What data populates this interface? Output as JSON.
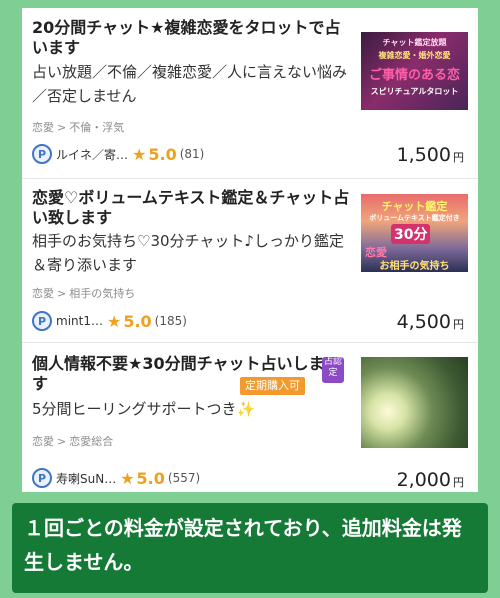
{
  "listings": [
    {
      "title": "20分間チャット★複雑恋愛をタロットで占います",
      "description": "占い放題／不倫／複雑恋愛／人に言えない悩み／否定しません",
      "category": [
        "恋愛",
        "不倫・浮気"
      ],
      "seller": "ルイネ／寄…",
      "rating": "5.0",
      "reviews": "(81)",
      "price": "1,500",
      "currency": "円",
      "thumbnail_text": [
        "チャット鑑定放題",
        "複雑恋愛・婚外恋愛",
        "ご事情のある恋",
        "スピリチュアルタロット"
      ]
    },
    {
      "title": "恋愛♡ボリュームテキスト鑑定＆チャット占い致します",
      "description": "相手のお気持ち♡30分チャット♪しっかり鑑定＆寄り添います",
      "category": [
        "恋愛",
        "相手の気持ち"
      ],
      "seller": "mint1…",
      "rating": "5.0",
      "reviews": "(185)",
      "price": "4,500",
      "currency": "円",
      "thumbnail_text": [
        "チャット鑑定",
        "ボリュームテキスト鑑定付き",
        "30分",
        "恋愛",
        "お相手の気持ち"
      ]
    },
    {
      "title": "個人情報不要★30分間チャット占いします",
      "description": "5分間ヒーリングサポートつき✨",
      "category": [
        "恋愛",
        "恋愛総合"
      ],
      "seller": "寿喇SuN…",
      "rating": "5.0",
      "reviews": "(557)",
      "price": "2,000",
      "currency": "円",
      "tag": "定期購入可",
      "cert_badge": "占認定"
    }
  ],
  "caption": "１回ごとの料金が設定されており、追加料金は発生しません。",
  "colors": {
    "background": "#7fcf95",
    "caption_bg": "#147a36",
    "star": "#f0a020",
    "tag": "#f29a2e",
    "badge": "#3f74c7"
  }
}
